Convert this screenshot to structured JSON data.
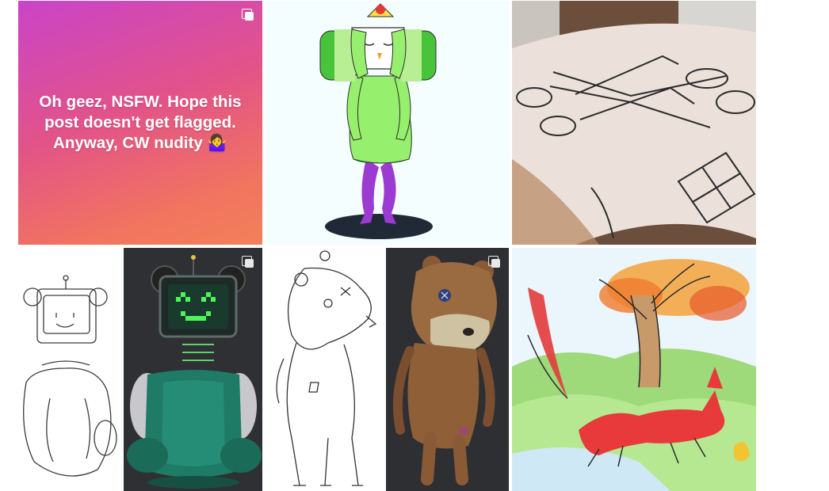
{
  "grid": {
    "posts": [
      {
        "type": "text-post",
        "caption": "Oh geez, NSFW. Hope this post doesn't get flagged. Anyway, CW nudity 🤷‍♀️",
        "multiple_images": true,
        "colors": {
          "gradient_start": "#c944c8",
          "gradient_end": "#f3805a"
        }
      },
      {
        "type": "image",
        "subject": "katamari-prince-character-drawing",
        "multiple_images": false
      },
      {
        "type": "image",
        "subject": "scissors-and-tetris-tattoo-photo",
        "multiple_images": false
      },
      {
        "type": "image",
        "subject": "tv-head-bear-pencil-sketch",
        "multiple_images": false
      },
      {
        "type": "image",
        "subject": "3d-tv-head-bear-render",
        "multiple_images": true
      },
      {
        "type": "image",
        "subject": "stuffed-bear-pencil-sketch",
        "multiple_images": false
      },
      {
        "type": "image",
        "subject": "3d-knitted-bear-render",
        "multiple_images": true
      },
      {
        "type": "image",
        "subject": "watercolor-fox-and-autumn-tree",
        "multiple_images": false
      }
    ]
  }
}
